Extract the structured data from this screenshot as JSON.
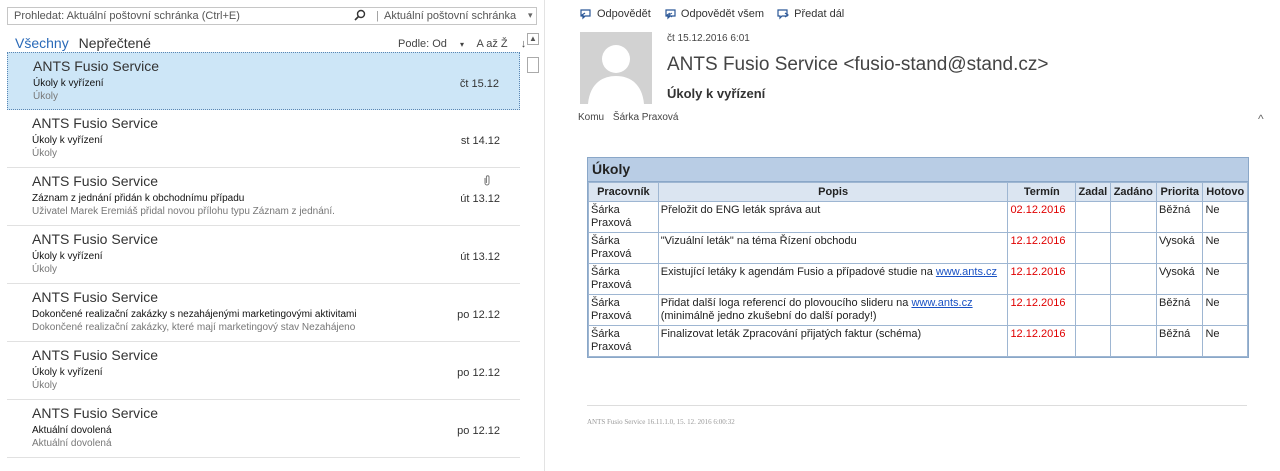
{
  "search": {
    "placeholder": "Prohledat: Aktuální poštovní schránka (Ctrl+E)",
    "scope": "Aktuální poštovní schránka",
    "icon": "search-icon"
  },
  "filters": {
    "all": "Všechny",
    "unread": "Nepřečtené"
  },
  "sort": {
    "by": "Podle: Od",
    "order": "A až Ž"
  },
  "messages": [
    {
      "sender": "ANTS Fusio Service",
      "subject": "Úkoly k vyřízení",
      "preview": "Úkoly",
      "date": "čt 15.12",
      "selected": true,
      "attachment": false
    },
    {
      "sender": "ANTS Fusio Service",
      "subject": "Úkoly k vyřízení",
      "preview": "Úkoly",
      "date": "st 14.12",
      "selected": false,
      "attachment": false
    },
    {
      "sender": "ANTS Fusio Service",
      "subject": "Záznam z jednání přidán k obchodnímu případu",
      "preview": "Uživatel Marek Eremiáš přidal novou přílohu typu Záznam z jednání.",
      "date": "út 13.12",
      "selected": false,
      "attachment": true
    },
    {
      "sender": "ANTS Fusio Service",
      "subject": "Úkoly k vyřízení",
      "preview": "Úkoly",
      "date": "út 13.12",
      "selected": false,
      "attachment": false
    },
    {
      "sender": "ANTS Fusio Service",
      "subject": "Dokončené realizační zakázky s nezahájenými marketingovými aktivitami",
      "preview": "Dokončené realizační zakázky, které mají marketingový stav Nezahájeno",
      "date": "po 12.12",
      "selected": false,
      "attachment": false
    },
    {
      "sender": "ANTS Fusio Service",
      "subject": "Úkoly k vyřízení",
      "preview": "Úkoly",
      "date": "po 12.12",
      "selected": false,
      "attachment": false
    },
    {
      "sender": "ANTS Fusio Service",
      "subject": "Aktuální dovolená",
      "preview": "Aktuální dovolená",
      "date": "po 12.12",
      "selected": false,
      "attachment": false
    }
  ],
  "toolbar": {
    "reply": "Odpovědět",
    "reply_all": "Odpovědět všem",
    "forward": "Předat dál"
  },
  "message": {
    "date": "čt 15.12.2016 6:01",
    "from": "ANTS Fusio Service <fusio-stand@stand.cz>",
    "subject": "Úkoly k vyřízení",
    "to_label": "Komu",
    "to": "Šárka Praxová"
  },
  "tasks": {
    "title": "Úkoly",
    "headers": [
      "Pracovník",
      "Popis",
      "Termín",
      "Zadal",
      "Zadáno",
      "Priorita",
      "Hotovo"
    ],
    "rows": [
      {
        "worker": "Šárka Praxová",
        "desc": "Přeložit do ENG leták správa aut",
        "link": "",
        "desc_after": "",
        "term": "02.12.2016",
        "by": "",
        "assigned": "",
        "priority": "Běžná",
        "done": "Ne"
      },
      {
        "worker": "Šárka Praxová",
        "desc": "\"Vizuální leták\" na téma Řízení obchodu",
        "link": "",
        "desc_after": "",
        "term": "12.12.2016",
        "by": "",
        "assigned": "",
        "priority": "Vysoká",
        "done": "Ne"
      },
      {
        "worker": "Šárka Praxová",
        "desc": "Existující letáky k agendám Fusio a případové studie na ",
        "link": "www.ants.cz",
        "desc_after": "",
        "term": "12.12.2016",
        "by": "",
        "assigned": "",
        "priority": "Vysoká",
        "done": "Ne"
      },
      {
        "worker": "Šárka Praxová",
        "desc": "Přidat další loga referencí do plovoucího slideru na ",
        "link": "www.ants.cz",
        "desc_after": " (minimálně jedno zkušební do další porady!)",
        "term": "12.12.2016",
        "by": "",
        "assigned": "",
        "priority": "Běžná",
        "done": "Ne"
      },
      {
        "worker": "Šárka Praxová",
        "desc": "Finalizovat leták Zpracování přijatých faktur (schéma)",
        "link": "",
        "desc_after": "",
        "term": "12.12.2016",
        "by": "",
        "assigned": "",
        "priority": "Běžná",
        "done": "Ne"
      }
    ]
  },
  "footer": "ANTS Fusio Service 16.11.1.0, 15. 12. 2016 6:00:32",
  "colors": {
    "accent": "#2a6ab8",
    "selected_bg": "#cde6f7",
    "term_red": "#e00000",
    "table_header": "#b9cde5"
  }
}
